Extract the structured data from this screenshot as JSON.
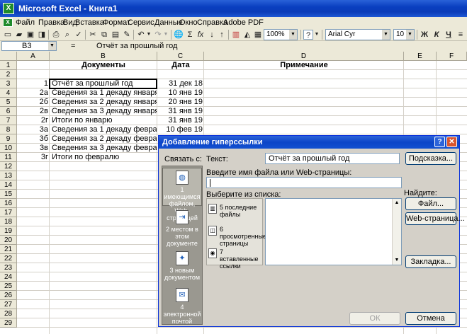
{
  "window": {
    "title": "Microsoft Excel - Книга1",
    "app_icon": "X"
  },
  "menu": [
    "Файл",
    "Правка",
    "Вид",
    "Вставка",
    "Формат",
    "Сервис",
    "Данные",
    "Окно",
    "Справка",
    "Adobe PDF"
  ],
  "toolbar": {
    "zoom": "100%",
    "font": "Arial Cyr",
    "size": "10",
    "bold": "Ж",
    "italic": "К",
    "underline": "Ч",
    "sigma": "Σ",
    "fx": "fx",
    "help": "?"
  },
  "formula_bar": {
    "name_box": "B3",
    "equals": "=",
    "content": "Отчёт за прошлый год"
  },
  "sheet": {
    "columns": [
      "A",
      "B",
      "C",
      "D",
      "E",
      "F"
    ],
    "rows": [
      "1",
      "2",
      "3",
      "4",
      "5",
      "6",
      "7",
      "8",
      "9",
      "10",
      "11",
      "12",
      "13",
      "14",
      "15",
      "16",
      "17",
      "18",
      "19",
      "20",
      "21",
      "22",
      "23",
      "24",
      "25",
      "26",
      "27",
      "28",
      "29"
    ],
    "header_row": {
      "B": "Документы",
      "C": "Дата",
      "D": "Примечание"
    },
    "data": [
      {
        "a": "1",
        "b": "Отчёт за прошлый год",
        "c": "31 дек 18"
      },
      {
        "a": "2а",
        "b": "Сведения за 1 декаду января",
        "c": "10 янв 19"
      },
      {
        "a": "2б",
        "b": "Сведения за 2 декаду января",
        "c": "20 янв 19"
      },
      {
        "a": "2в",
        "b": "Сведения за 3 декаду января",
        "c": "31 янв 19"
      },
      {
        "a": "2г",
        "b": "Итоги по январю",
        "c": "31 янв 19"
      },
      {
        "a": "3а",
        "b": "Сведения за 1 декаду февраля",
        "c": "10 фев 19"
      },
      {
        "a": "3б",
        "b": "Сведения за 2 декаду февраля",
        "c": ""
      },
      {
        "a": "3в",
        "b": "Сведения за 3 декаду февраля",
        "c": ""
      },
      {
        "a": "3г",
        "b": "Итоги по февралю",
        "c": ""
      }
    ]
  },
  "dialog": {
    "title": "Добавление гиперссылки",
    "link_to_label": "Связать с:",
    "text_label": "Текст:",
    "text_value": "Отчёт за прошлый год",
    "hint_button": "Подсказка...",
    "filename_label": "Введите имя файла или Web-страницы:",
    "filename_value": "",
    "choose_label": "Выберите из списка:",
    "find_label": "Найдите:",
    "file_button": "Файл...",
    "web_button": "Web-страница...",
    "bookmark_button": "Закладка...",
    "ok_button": "ОК",
    "cancel_button": "Отмена",
    "help_btn": "?",
    "close_btn": "✕",
    "link_targets": [
      {
        "label": "1 имеющимся файлом, Web-страницей",
        "icon": "file-web-icon"
      },
      {
        "label": "2 местом в этом документе",
        "icon": "document-place-icon"
      },
      {
        "label": "3 новым документом",
        "icon": "new-document-icon"
      },
      {
        "label": "4 электронной почтой",
        "icon": "email-icon"
      }
    ],
    "sources": [
      {
        "label": "5 последние файлы",
        "icon": "recent-files-icon"
      },
      {
        "label": "6 просмотренные страницы",
        "icon": "browsed-pages-icon"
      },
      {
        "label": "7 вставленные ссылки",
        "icon": "inserted-links-icon"
      }
    ]
  }
}
